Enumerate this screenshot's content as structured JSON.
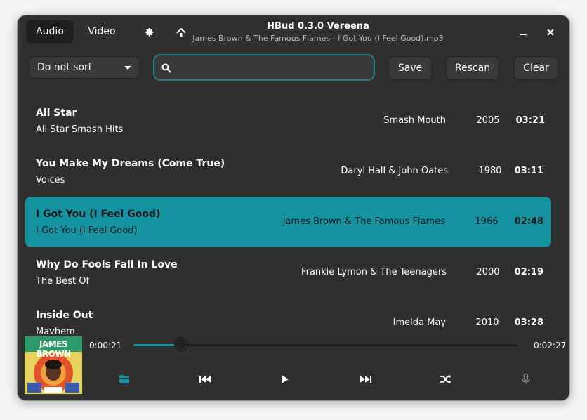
{
  "header": {
    "tabs": [
      {
        "label": "Audio",
        "active": true
      },
      {
        "label": "Video",
        "active": false
      }
    ],
    "settings_icon": "gear-icon",
    "update_icon": "upload-arrow-icon",
    "title": "HBud 0.3.0 Vereena",
    "subtitle": "James Brown & The Famous Flames - I Got You (I Feel Good).mp3",
    "minimize_icon": "minimize-icon",
    "close_icon": "close-icon"
  },
  "toolbar": {
    "sort_value": "Do not sort",
    "search_value": "",
    "save_label": "Save",
    "rescan_label": "Rescan",
    "clear_label": "Clear"
  },
  "tracks": [
    {
      "title": "All Star",
      "album": "All Star Smash Hits",
      "artist": "Smash Mouth",
      "year": "2005",
      "duration": "03:21",
      "selected": false
    },
    {
      "title": "You Make My Dreams (Come True)",
      "album": "Voices",
      "artist": "Daryl Hall & John Oates",
      "year": "1980",
      "duration": "03:11",
      "selected": false
    },
    {
      "title": "I Got You (I Feel Good)",
      "album": "I Got You (I Feel Good)",
      "artist": "James Brown & The Famous Flames",
      "year": "1966",
      "duration": "02:48",
      "selected": true
    },
    {
      "title": "Why Do Fools Fall In Love",
      "album": "The Best Of",
      "artist": "Frankie Lymon & The Teenagers",
      "year": "2000",
      "duration": "02:19",
      "selected": false
    },
    {
      "title": "Inside Out",
      "album": "Mayhem",
      "artist": "Imelda May",
      "year": "2010",
      "duration": "03:28",
      "selected": false
    }
  ],
  "player": {
    "elapsed": "0:00:21",
    "remaining": "0:02:27",
    "progress_fraction": 0.125,
    "cover_text": "JAMES BROWN",
    "buttons": [
      "folder-icon",
      "previous-icon",
      "play-icon",
      "next-icon",
      "shuffle-icon",
      "microphone-icon"
    ]
  },
  "colors": {
    "accent": "#1592a0",
    "window_bg": "#2f2f2f",
    "button_bg": "#3a3a3a"
  }
}
